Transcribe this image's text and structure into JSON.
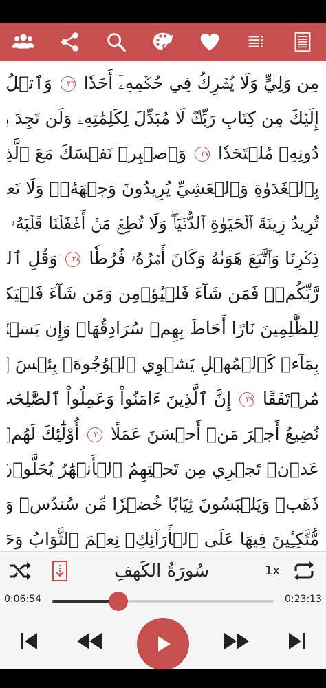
{
  "toolbar": {
    "icons": [
      "group-icon",
      "share-icon",
      "search-icon",
      "palette-icon",
      "heart-icon",
      "list-icon",
      "page-icon"
    ]
  },
  "reader": {
    "lines": [
      "مِن وَلِيٍّ وَلَا يُشۡرِكُ فِي حُكۡمِهِۦٓ أَحَدٗا ٢٦ وَٱتۡلُ مَآ أُوحِيَ",
      "إِلَيۡكَ مِن كِتَابِ رَبِّكَۖ لَا مُبَدِّلَ لِكَلِمَٰتِهِۦ وَلَن تَجِدَ مِن",
      "دُونِهِۦ مُلۡتَحَدٗا ٢٧ وَٱصۡبِرۡ نَفۡسَكَ مَعَ ٱلَّذِينَ يَدۡعُونَ رَبَّهُم",
      "بِٱلۡغَدَوٰةِ وَٱلۡعَشِيِّ يُرِيدُونَ وَجۡهَهُۥۖ وَلَا تَعۡدُ عَيۡنَاكَ عَنۡهُمۡ",
      "تُرِيدُ زِينَةَ ٱلۡحَيَوٰةِ ٱلدُّنۡيَاۖ وَلَا تُطِعۡ مَنۡ أَغۡفَلۡنَا قَلۡبَهُۥ عَن",
      "ذِكۡرِنَا وَٱتَّبَعَ هَوَىٰهُ وَكَانَ أَمۡرُهُۥ فُرُطٗا ٢٨ وَقُلِ ٱلۡحَقُّ مِن",
      "رَّبِّكُمۡۖ فَمَن شَآءَ فَلۡيُؤۡمِن وَمَن شَآءَ فَلۡيَكۡفُرۡۚ إِنَّآ أَعۡتَدۡنَا",
      "لِلظَّٰلِمِينَ نَارًا أَحَاطَ بِهِمۡ سُرَادِقُهَاۚ وَإِن يَسۡتَغِيثُواْ يُغَاثُواْ",
      "بِمَآءٖ كَٱلۡمُهۡلِ يَشۡوِي ٱلۡوُجُوهَۚ بِئۡسَ ٱلشَّرَابُ وَسَآءَتۡ",
      "مُرۡتَفَقًا ٢٩ إِنَّ ٱلَّذِينَ ءَامَنُواْ وَعَمِلُواْ ٱلصَّٰلِحَٰتِ إِنَّا لَا",
      "نُضِيعُ أَجۡرَ مَنۡ أَحۡسَنَ عَمَلًا ٣٠ أُوْلَٰٓئِكَ لَهُمۡ جَنَّٰتُ",
      "عَدۡنٖ تَجۡرِي مِن تَحۡتِهِمُ ٱلۡأَنۡهَٰرُ يُحَلَّوۡنَ فِيهَا مِنۡ أَسَاوِرَ مِن",
      "ذَهَبٖ وَيَلۡبَسُونَ ثِيَابًا خُضۡرٗا مِّن سُندُسٖ وَإِسۡتَبۡرَقٖ",
      "مُّتَّكِـِٔينَ فِيهَا عَلَى ٱلۡأَرَآئِكِۚ نِعۡمَ ٱلثَّوَابُ وَحَسُنَتۡ مُرۡتَفَقٗا"
    ]
  },
  "player": {
    "surah_title": "سُورَةُ الكَهفِ",
    "speed": "1x",
    "time_elapsed": "0:06:54",
    "time_total": "0:23:13",
    "progress": 0.297,
    "accent_color": "#c74f4f"
  }
}
